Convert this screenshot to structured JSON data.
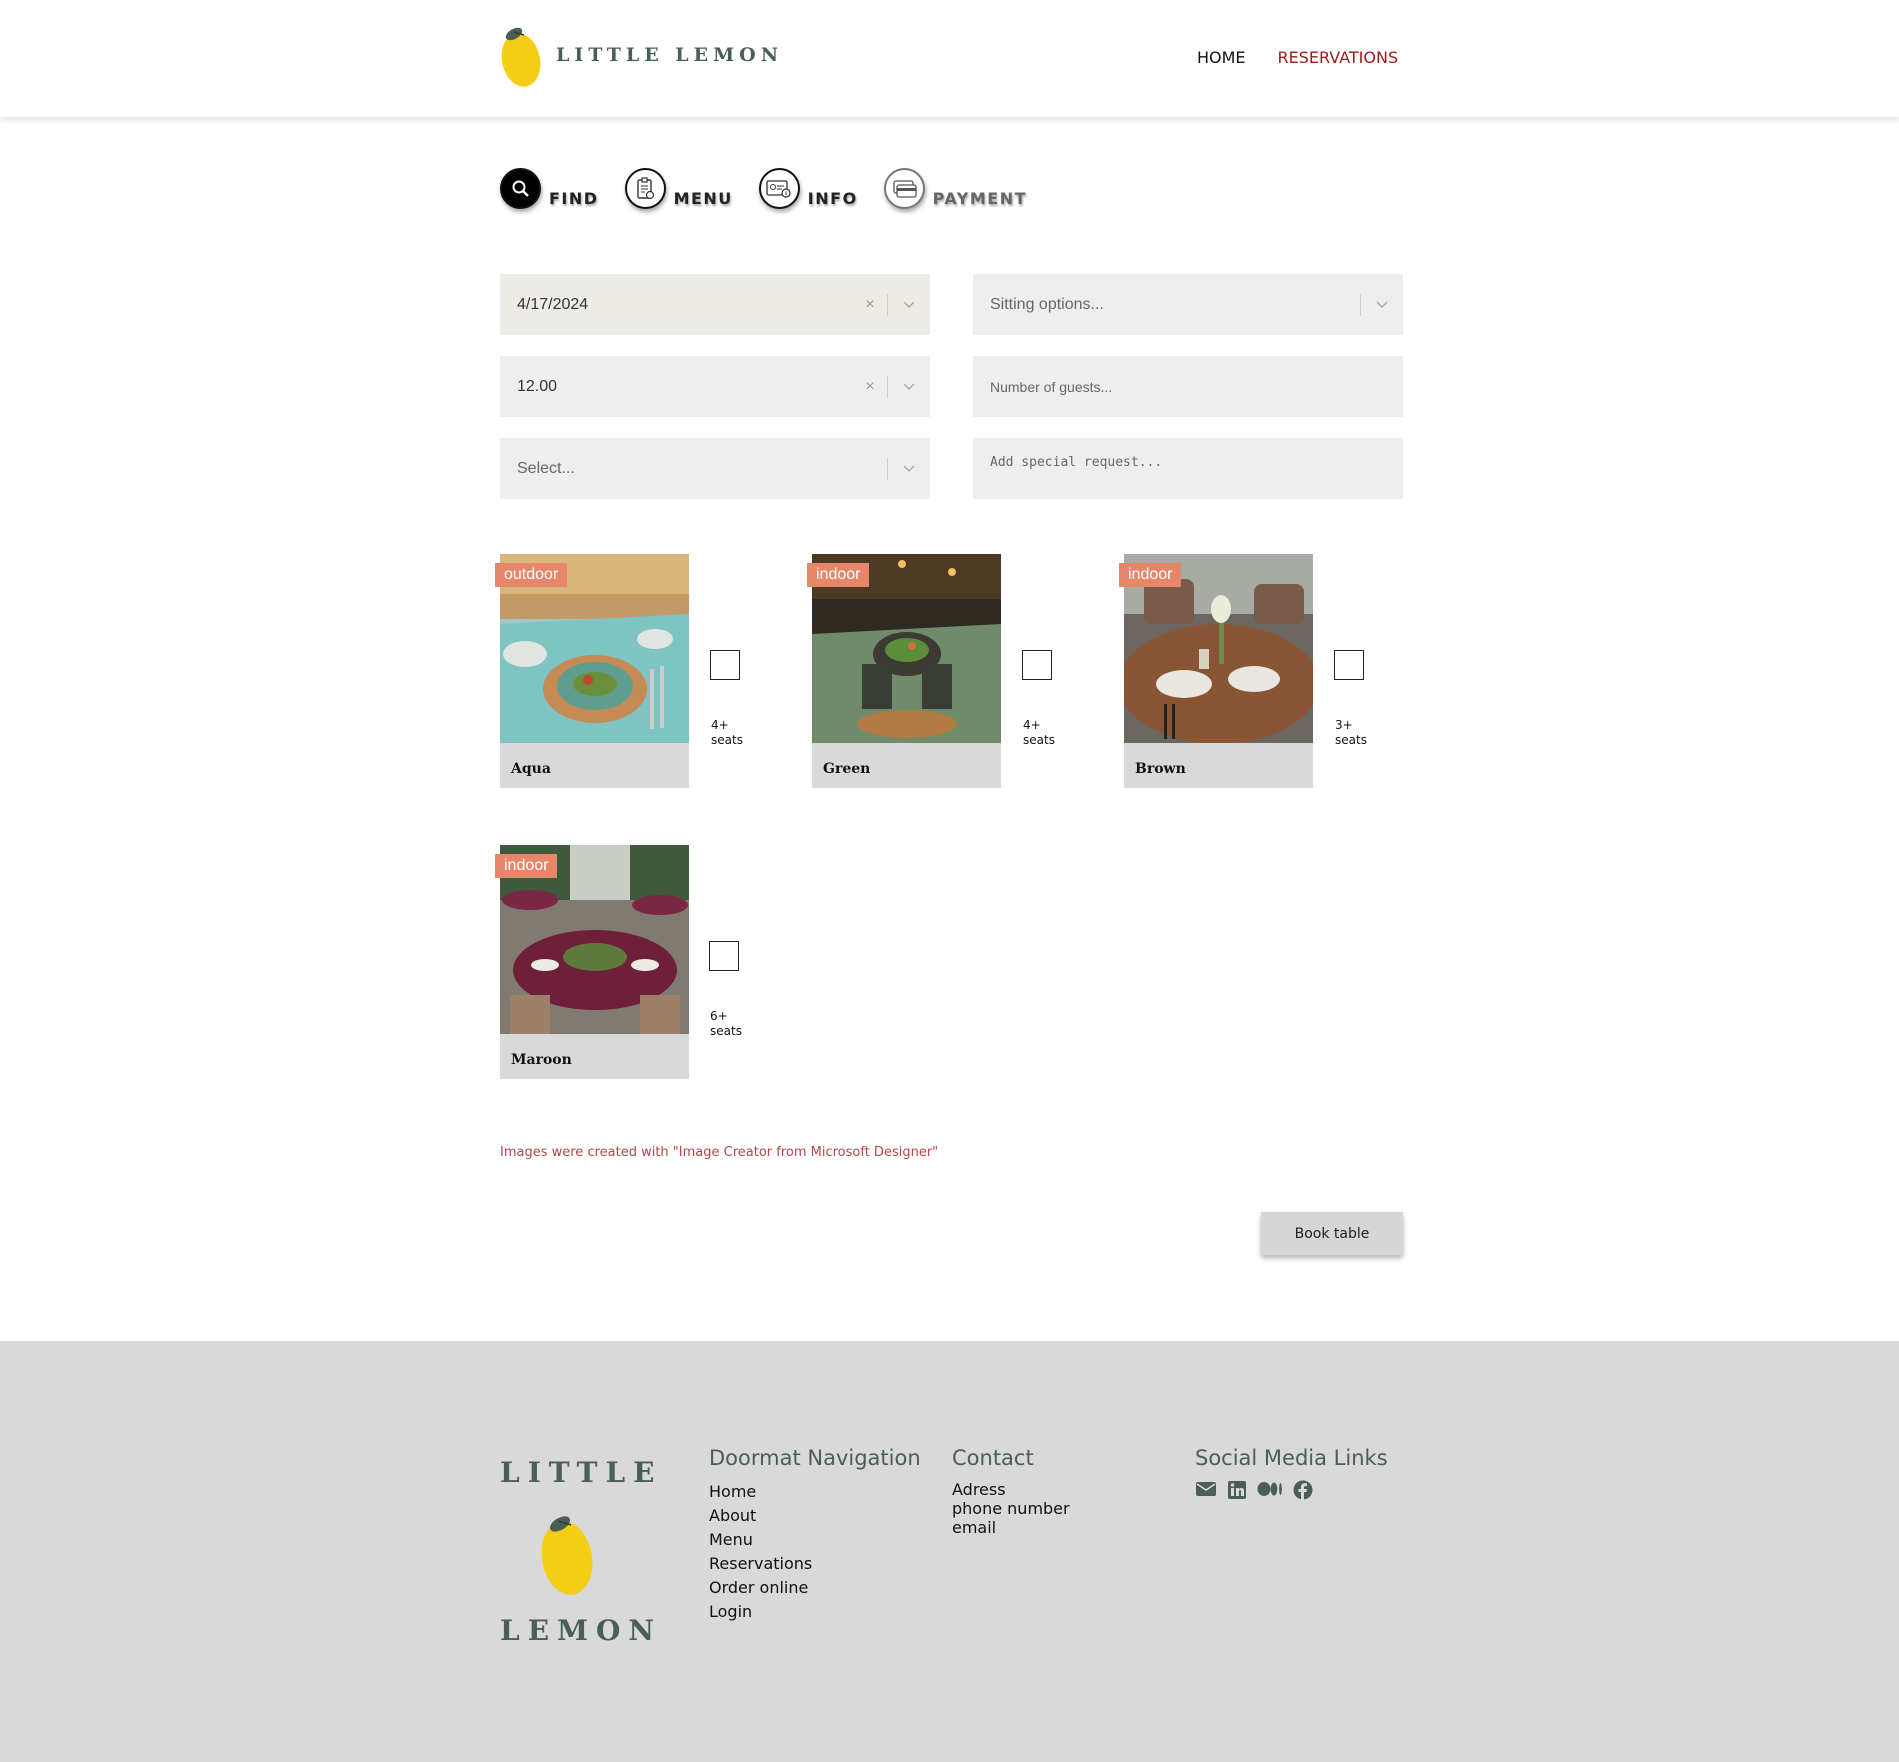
{
  "header": {
    "brand": "LITTLE LEMON",
    "nav": {
      "home": "HOME",
      "reservations": "RESERVATIONS"
    }
  },
  "steps": [
    {
      "label": "FIND",
      "icon": "search-icon",
      "active": true
    },
    {
      "label": "MENU",
      "icon": "clipboard-icon",
      "active": false
    },
    {
      "label": "INFO",
      "icon": "id-card-icon",
      "active": false
    },
    {
      "label": "PAYMENT",
      "icon": "credit-card-icon",
      "active": false
    }
  ],
  "form": {
    "date": {
      "value": "4/17/2024",
      "clear": "×"
    },
    "time": {
      "value": "12.00",
      "clear": "×"
    },
    "occasion": {
      "placeholder": "Select..."
    },
    "sitting": {
      "placeholder": "Sitting options..."
    },
    "guests": {
      "placeholder": "Number of guests..."
    },
    "request": {
      "placeholder": "Add special request..."
    }
  },
  "tables": [
    {
      "name": "Aqua",
      "tag": "outdoor",
      "seats": "4+",
      "seats_unit": "seats",
      "checked": false,
      "color": "#7ec4c2"
    },
    {
      "name": "Green",
      "tag": "indoor",
      "seats": "4+",
      "seats_unit": "seats",
      "checked": false,
      "color": "#6f8b6a"
    },
    {
      "name": "Brown",
      "tag": "indoor",
      "seats": "3+",
      "seats_unit": "seats",
      "checked": false,
      "color": "#8a5534"
    },
    {
      "name": "Maroon",
      "tag": "indoor",
      "seats": "6+",
      "seats_unit": "seats",
      "checked": false,
      "color": "#6e1f3a"
    }
  ],
  "credit": "Images were created with \"Image Creator from Microsoft Designer\"",
  "book_button": "Book table",
  "footer": {
    "brand_top": "LITTLE",
    "brand_bottom": "LEMON",
    "nav_title": "Doormat Navigation",
    "nav_links": [
      "Home",
      "About",
      "Menu",
      "Reservations",
      "Order online",
      "Login"
    ],
    "contact_title": "Contact",
    "contact_lines": [
      "Adress",
      "phone number",
      "email"
    ],
    "social_title": "Social Media Links",
    "social_icons": [
      "email-icon",
      "linkedin-icon",
      "medium-icon",
      "facebook-icon"
    ]
  },
  "colors": {
    "brand_green": "#495e57",
    "lemon_yellow": "#f4ce14",
    "active_nav": "#9b1b1b",
    "tag": "#e6876b",
    "footer_bg": "#d9d9d9"
  }
}
